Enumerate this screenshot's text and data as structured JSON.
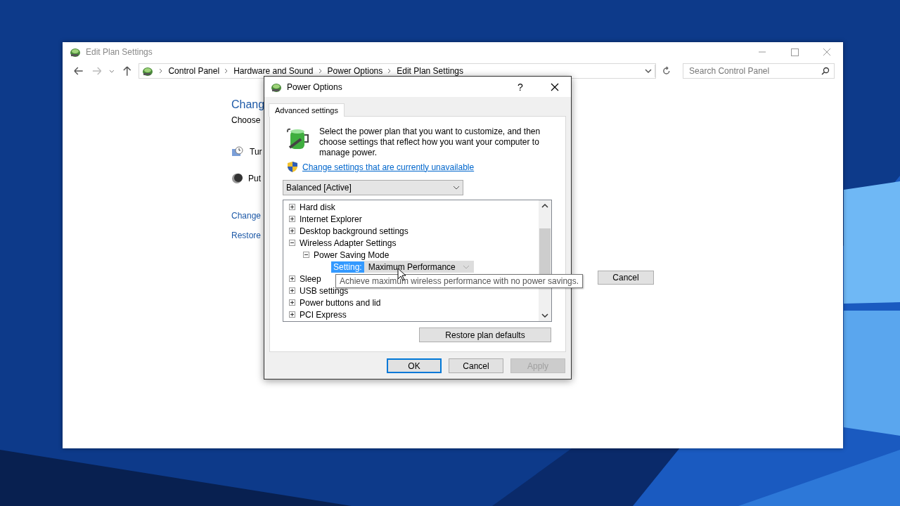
{
  "main_window": {
    "title": "Edit Plan Settings",
    "breadcrumbs": [
      "Control Panel",
      "Hardware and Sound",
      "Power Options",
      "Edit Plan Settings"
    ],
    "search": {
      "placeholder": "Search Control Panel"
    },
    "heading": "Chang",
    "subtext": "Choose",
    "options": [
      {
        "kind": "display",
        "label": "Tur"
      },
      {
        "kind": "sleep",
        "label": "Put"
      }
    ],
    "links": [
      "Change",
      "Restore"
    ],
    "buttons": [
      "Cancel"
    ]
  },
  "dialog": {
    "title": "Power Options",
    "help": "?",
    "tabs": [
      {
        "label": "Advanced settings",
        "selected": true
      }
    ],
    "intro": "Select the power plan that you want to customize, and then choose settings that reflect how you want your computer to manage power.",
    "admin_link": "Change settings that are currently unavailable",
    "plan": "Balanced [Active]",
    "tree": [
      {
        "label": "Hard disk",
        "expanded": false
      },
      {
        "label": "Internet Explorer",
        "expanded": false
      },
      {
        "label": "Desktop background settings",
        "expanded": false
      },
      {
        "label": "Wireless Adapter Settings",
        "expanded": true,
        "children": [
          {
            "label": "Power Saving Mode",
            "expanded": true,
            "setting": {
              "label": "Setting:",
              "value": "Maximum Performance",
              "selected": true
            }
          }
        ]
      },
      {
        "label": "Sleep",
        "expanded": false
      },
      {
        "label": "USB settings",
        "expanded": false
      },
      {
        "label": "Power buttons and lid",
        "expanded": false
      },
      {
        "label": "PCI Express",
        "expanded": false
      }
    ],
    "tooltip": "Achieve maximum wireless performance with no power savings.",
    "restore_button": "Restore plan defaults",
    "buttons": [
      {
        "label": "OK",
        "kind": "default",
        "disabled": false
      },
      {
        "label": "Cancel",
        "kind": "normal",
        "disabled": false
      },
      {
        "label": "Apply",
        "kind": "normal",
        "disabled": true
      }
    ]
  }
}
